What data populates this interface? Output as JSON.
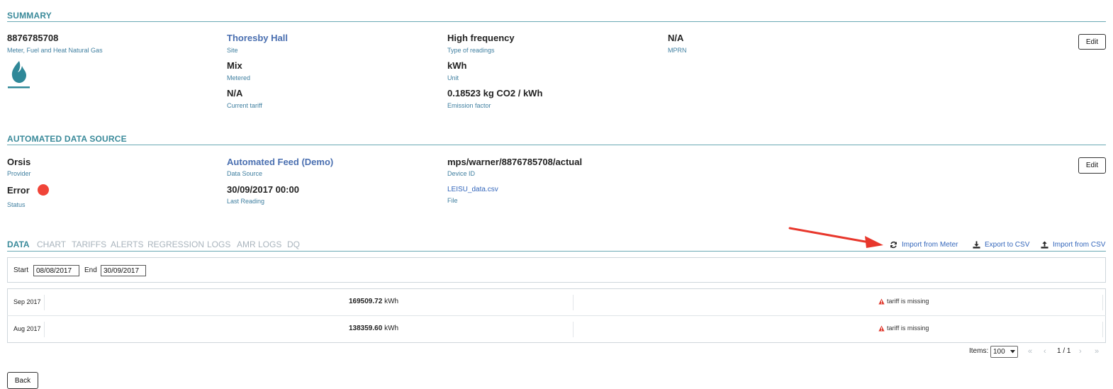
{
  "summary": {
    "title": "SUMMARY",
    "meter_number": "8876785708",
    "meter_type": "Meter, Fuel and Heat Natural Gas",
    "meter_icon": "gas-flame-icon",
    "site": {
      "value": "Thoresby Hall",
      "label": "Site"
    },
    "metered": {
      "value": "Mix",
      "label": "Metered"
    },
    "current_tariff": {
      "value": "N/A",
      "label": "Current tariff"
    },
    "type_of_readings": {
      "value": "High frequency",
      "label": "Type of readings"
    },
    "unit": {
      "value": "kWh",
      "label": "Unit"
    },
    "emission_factor": {
      "value": "0.18523 kg CO2 / kWh",
      "label": "Emission factor"
    },
    "mprn": {
      "value": "N/A",
      "label": "MPRN"
    },
    "edit_label": "Edit"
  },
  "data_source": {
    "title": "AUTOMATED DATA SOURCE",
    "provider": {
      "value": "Orsis",
      "label": "Provider"
    },
    "status": {
      "value": "Error",
      "label": "Status",
      "color": "#f04438"
    },
    "source": {
      "value": "Automated Feed (Demo)",
      "label": "Data Source"
    },
    "last_reading": {
      "value": "30/09/2017 00:00",
      "label": "Last Reading"
    },
    "device_id": {
      "value": "mps/warner/8876785708/actual",
      "label": "Device ID"
    },
    "file": {
      "value": "LEISU_data.csv",
      "label": "File"
    },
    "edit_label": "Edit"
  },
  "tabs": [
    {
      "label": "DATA",
      "active": true
    },
    {
      "label": "CHART"
    },
    {
      "label": "TARIFFS"
    },
    {
      "label": "ALERTS"
    },
    {
      "label": "REGRESSION"
    },
    {
      "label": "LOGS"
    },
    {
      "label": "AMR LOGS"
    },
    {
      "label": "DQ"
    }
  ],
  "actions": {
    "import_meter": "Import from Meter",
    "export_csv": "Export to CSV",
    "import_csv": "Import from CSV"
  },
  "filter": {
    "start_label": "Start",
    "start_value": "08/08/2017",
    "end_label": "End",
    "end_value": "30/09/2017"
  },
  "rows": [
    {
      "month": "Sep 2017",
      "amount": "169509.72",
      "unit": "kWh",
      "warning": "tariff is missing"
    },
    {
      "month": "Aug 2017",
      "amount": "138359.60",
      "unit": "kWh",
      "warning": "tariff is missing"
    }
  ],
  "pagination": {
    "items_label": "Items:",
    "items_value": "100",
    "page_text": "1 / 1",
    "first": "«",
    "prev": "‹",
    "next": "›",
    "last": "»"
  },
  "back_label": "Back",
  "colors": {
    "accent": "#3a8a9a",
    "link": "#3366bb",
    "error": "#f04438",
    "arrow": "#e8372c"
  }
}
